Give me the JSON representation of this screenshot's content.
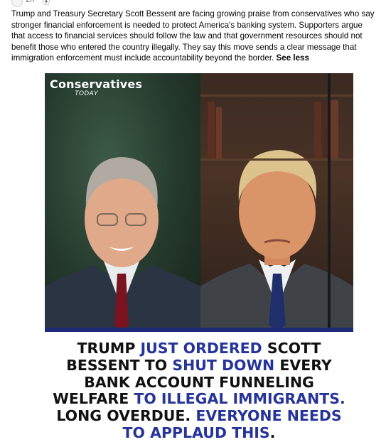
{
  "post": {
    "time": "2h",
    "text": "Trump and Treasury Secretary Scott Bessent are facing growing praise from conservatives who say stronger financial enforcement is needed to protect America's banking system. Supporters argue that access to financial services should follow the law and that government resources should not benefit those who entered the country illegally. They say this move sends a clear message that immigration enforcement must include accountability beyond the border.",
    "see_less": "See less"
  },
  "image": {
    "logo_main": "Conservatives",
    "logo_sub": "TODAY",
    "headline": [
      {
        "t": "TRUMP ",
        "c": "dark"
      },
      {
        "t": "JUST ORDERED",
        "c": "blue"
      },
      {
        "t": " SCOTT",
        "c": "dark"
      },
      {
        "t": "BESSENT TO ",
        "c": "dark"
      },
      {
        "t": "SHUT DOWN",
        "c": "blue"
      },
      {
        "t": " EVERY",
        "c": "dark"
      },
      {
        "t": "BANK ACCOUNT FUNNELING",
        "c": "dark"
      },
      {
        "t": "WELFARE ",
        "c": "dark"
      },
      {
        "t": "TO ILLEGAL IMMIGRANTS.",
        "c": "blue"
      },
      {
        "t": "LONG OVERDUE. ",
        "c": "dark"
      },
      {
        "t": "EVERYONE NEEDS",
        "c": "blue"
      },
      {
        "t": "TO APPLAUD THIS",
        "c": "blue"
      },
      {
        "t": ".",
        "c": "dark"
      }
    ],
    "colors": {
      "accent_blue": "#26349a",
      "bar_blue": "#1f2a78",
      "text_dark": "#111111"
    }
  }
}
